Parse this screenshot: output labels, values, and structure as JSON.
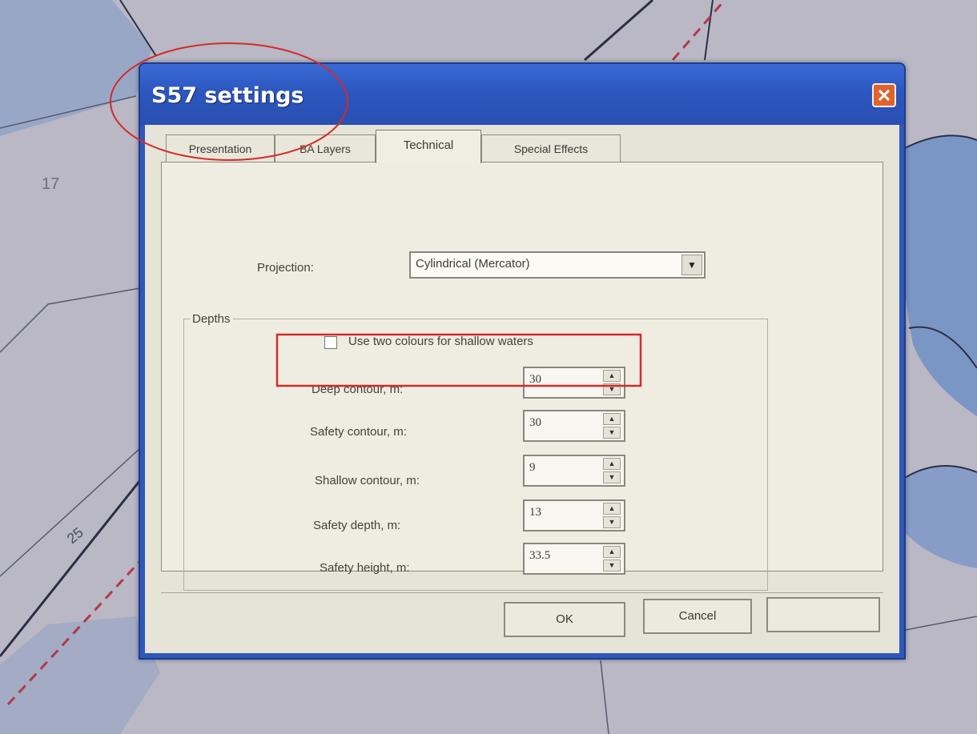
{
  "dialog": {
    "title": "S57 settings",
    "close_symbol": "✕"
  },
  "tabs": [
    {
      "label": "Presentation",
      "active": false
    },
    {
      "label": "BA Layers",
      "active": false
    },
    {
      "label": "Technical",
      "active": true
    },
    {
      "label": "Special Effects",
      "active": false
    }
  ],
  "technical": {
    "projection_label": "Projection:",
    "projection_value": "Cylindrical (Mercator)",
    "depths_label": "Depths",
    "shallow_colours": {
      "label": "Use two colours for shallow waters",
      "checked": false
    },
    "fields": [
      {
        "label": "Deep contour, m:",
        "value": "30"
      },
      {
        "label": "Safety contour, m:",
        "value": "30"
      },
      {
        "label": "Shallow contour, m:",
        "value": "9"
      },
      {
        "label": "Safety depth, m:",
        "value": "13"
      },
      {
        "label": "Safety height, m:",
        "value": "33.5"
      }
    ]
  },
  "buttons": {
    "ok": "OK",
    "cancel": "Cancel",
    "third": ""
  },
  "map_labels": {
    "soundings": [
      "17",
      "25"
    ]
  },
  "colors": {
    "titlebar": "#2c57bf",
    "close": "#e0632f",
    "annotation": "#d32b2b"
  },
  "icons": {
    "close": "close-icon",
    "dropdown": "chevron-down-icon",
    "spin_up": "spin-up-icon",
    "spin_down": "spin-down-icon"
  }
}
